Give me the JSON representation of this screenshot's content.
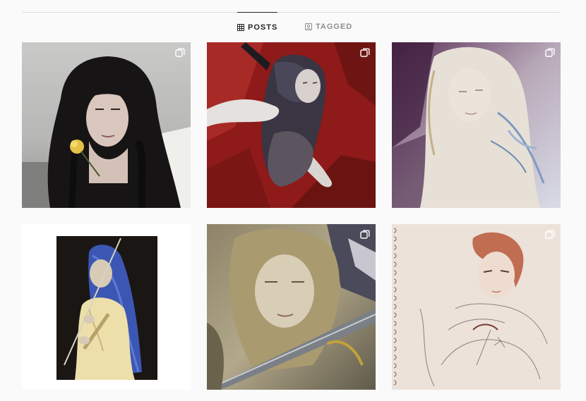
{
  "tabs": [
    {
      "label": "POSTS",
      "icon": "grid-icon",
      "active": true
    },
    {
      "label": "TAGGED",
      "icon": "tagged-icon",
      "active": false
    }
  ],
  "posts": [
    {
      "subject": "woman-with-dark-curly-hair-holding-yellow-flower",
      "multiple": true
    },
    {
      "subject": "painting-girl-reclining-on-red-background",
      "multiple": true
    },
    {
      "subject": "painting-pale-girl-in-white",
      "multiple": true
    },
    {
      "subject": "painting-blue-haired-girl-with-flute",
      "multiple": false
    },
    {
      "subject": "painting-girl-face-with-sword",
      "multiple": true
    },
    {
      "subject": "sketch-boy-with-red-hair",
      "multiple": true
    }
  ]
}
